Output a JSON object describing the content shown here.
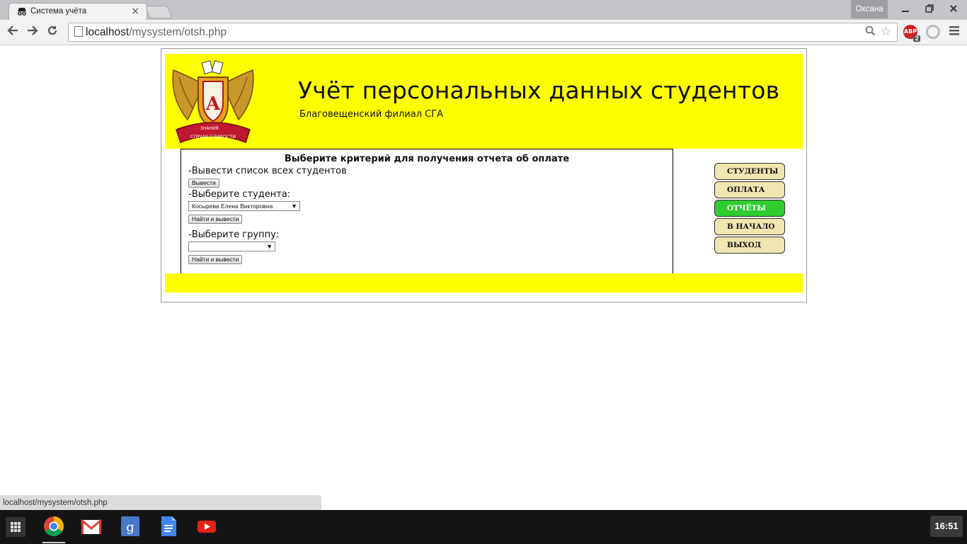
{
  "browser": {
    "tab_title": "Система учёта",
    "tab_close": "×",
    "profile_name": "Оксана",
    "url_host": "localhost",
    "url_path": "/mysystem/otsh.php",
    "abp_label": "ABP",
    "abp_count": "2",
    "status_url": "localhost/mysystem/otsh.php"
  },
  "header": {
    "title": "Учёт персональных данных студентов",
    "subtitle": "Благовещенский филиал СГА",
    "logo_text_top": "ЗНАНИЯ",
    "logo_text_bottom": "СПРАВЕДЛИВОСТИ",
    "logo_letter": "А"
  },
  "report_form": {
    "heading": "Выберите критерий для получения отчета об оплате",
    "all_students_label": "-Вывести список всех студентов",
    "output_button": "Вывести",
    "student_label": "-Выберите студента:",
    "student_selected": "Косырева Елена Викторовна",
    "find_button_student": "Найти и вывести",
    "group_label": "-Выберите группу:",
    "group_selected": "",
    "find_button_group": "Найти и вывести"
  },
  "nav": {
    "items": [
      {
        "label": "СТУДЕНТЫ",
        "active": false
      },
      {
        "label": "ОПЛАТА",
        "active": false
      },
      {
        "label": "ОТЧЁТЫ",
        "active": true
      },
      {
        "label": "В НАЧАЛО",
        "active": false
      },
      {
        "label": "ВЫХОД",
        "active": false
      }
    ]
  },
  "taskbar": {
    "time": "16:51"
  },
  "colors": {
    "banner": "#ffff00",
    "nav_button": "#f0e6b0",
    "nav_active": "#2fcc2f"
  }
}
